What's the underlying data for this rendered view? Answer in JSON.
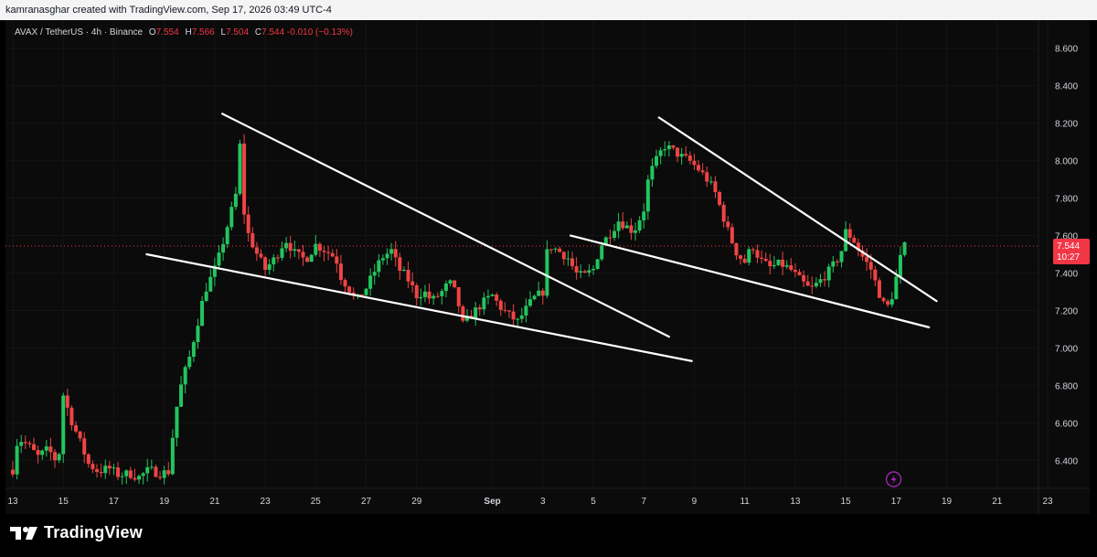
{
  "header": {
    "attribution": "kamranasghar created with TradingView.com, Sep 17, 2026 03:49 UTC-4"
  },
  "legend": {
    "symbol": "AVAX / TetherUS · 4h · Binance",
    "o_label": "O",
    "o_value": "7.554",
    "h_label": "H",
    "h_value": "7.566",
    "l_label": "L",
    "l_value": "7.504",
    "c_label": "C",
    "c_value": "7.544",
    "change": "-0.010 (−0.13%)"
  },
  "price_tag": {
    "price": "7.544",
    "countdown": "10:27"
  },
  "brand": {
    "name": "TradingView"
  },
  "colors": {
    "up": "#22c55e",
    "down": "#ef4444",
    "trendline": "#ffffff",
    "tag": "#f23645",
    "grid": "#141414"
  },
  "chart_data": {
    "type": "candlestick",
    "title": "AVAX / TetherUS · 4h · Binance",
    "y_axis": {
      "range": [
        6.25,
        8.75
      ],
      "ticks": [
        "6.400",
        "6.600",
        "6.800",
        "7.000",
        "7.200",
        "7.400",
        "7.600",
        "7.800",
        "8.000",
        "8.200",
        "8.400",
        "8.600"
      ]
    },
    "x_axis": {
      "range": [
        13,
        54
      ],
      "ticks": [
        {
          "t": 13,
          "label": "13"
        },
        {
          "t": 15,
          "label": "15"
        },
        {
          "t": 17,
          "label": "17"
        },
        {
          "t": 19,
          "label": "19"
        },
        {
          "t": 21,
          "label": "21"
        },
        {
          "t": 23,
          "label": "23"
        },
        {
          "t": 25,
          "label": "25"
        },
        {
          "t": 27,
          "label": "27"
        },
        {
          "t": 29,
          "label": "29"
        },
        {
          "t": 32,
          "label": "Sep"
        },
        {
          "t": 34,
          "label": "3"
        },
        {
          "t": 36,
          "label": "5"
        },
        {
          "t": 38,
          "label": "7"
        },
        {
          "t": 40,
          "label": "9"
        },
        {
          "t": 42,
          "label": "11"
        },
        {
          "t": 44,
          "label": "13"
        },
        {
          "t": 46,
          "label": "15"
        },
        {
          "t": 48,
          "label": "17"
        },
        {
          "t": 50,
          "label": "19"
        },
        {
          "t": 52,
          "label": "21"
        },
        {
          "t": 54,
          "label": "23"
        }
      ]
    },
    "current_price": 7.544,
    "closes_anchor": [
      [
        13,
        6.35
      ],
      [
        13.2,
        6.52
      ],
      [
        13.6,
        6.48
      ],
      [
        14,
        6.42
      ],
      [
        14.4,
        6.46
      ],
      [
        14.8,
        6.38
      ],
      [
        15,
        6.75
      ],
      [
        15.3,
        6.62
      ],
      [
        15.6,
        6.52
      ],
      [
        16,
        6.38
      ],
      [
        16.4,
        6.34
      ],
      [
        16.8,
        6.36
      ],
      [
        17.2,
        6.32
      ],
      [
        17.6,
        6.33
      ],
      [
        18,
        6.31
      ],
      [
        18.4,
        6.35
      ],
      [
        18.8,
        6.33
      ],
      [
        19.2,
        6.34
      ],
      [
        19.4,
        6.62
      ],
      [
        19.7,
        6.82
      ],
      [
        20,
        6.95
      ],
      [
        20.3,
        7.12
      ],
      [
        20.6,
        7.3
      ],
      [
        21,
        7.42
      ],
      [
        21.2,
        7.5
      ],
      [
        21.5,
        7.65
      ],
      [
        21.9,
        7.85
      ],
      [
        22,
        8.08
      ],
      [
        22.2,
        7.65
      ],
      [
        22.6,
        7.52
      ],
      [
        23,
        7.42
      ],
      [
        23.4,
        7.48
      ],
      [
        23.8,
        7.58
      ],
      [
        24.2,
        7.5
      ],
      [
        24.6,
        7.47
      ],
      [
        25,
        7.55
      ],
      [
        25.4,
        7.52
      ],
      [
        25.8,
        7.48
      ],
      [
        26,
        7.38
      ],
      [
        26.3,
        7.32
      ],
      [
        26.6,
        7.25
      ],
      [
        27,
        7.32
      ],
      [
        27.3,
        7.4
      ],
      [
        27.6,
        7.48
      ],
      [
        28,
        7.52
      ],
      [
        28.3,
        7.42
      ],
      [
        28.6,
        7.38
      ],
      [
        29,
        7.28
      ],
      [
        29.3,
        7.3
      ],
      [
        29.6,
        7.25
      ],
      [
        30,
        7.3
      ],
      [
        30.3,
        7.35
      ],
      [
        30.6,
        7.28
      ],
      [
        30.8,
        7.12
      ],
      [
        31.2,
        7.18
      ],
      [
        31.6,
        7.24
      ],
      [
        32,
        7.28
      ],
      [
        32.3,
        7.22
      ],
      [
        32.6,
        7.18
      ],
      [
        33,
        7.14
      ],
      [
        33.3,
        7.2
      ],
      [
        33.6,
        7.26
      ],
      [
        34,
        7.3
      ],
      [
        34.2,
        7.55
      ],
      [
        34.6,
        7.52
      ],
      [
        35,
        7.48
      ],
      [
        35.3,
        7.4
      ],
      [
        35.6,
        7.38
      ],
      [
        36,
        7.42
      ],
      [
        36.3,
        7.55
      ],
      [
        36.6,
        7.6
      ],
      [
        37,
        7.68
      ],
      [
        37.3,
        7.65
      ],
      [
        37.6,
        7.62
      ],
      [
        38,
        7.74
      ],
      [
        38.2,
        7.92
      ],
      [
        38.5,
        8.0
      ],
      [
        38.8,
        8.08
      ],
      [
        39.2,
        8.05
      ],
      [
        39.5,
        8.02
      ],
      [
        39.8,
        8.0
      ],
      [
        40.2,
        7.95
      ],
      [
        40.5,
        7.9
      ],
      [
        40.8,
        7.84
      ],
      [
        41.1,
        7.72
      ],
      [
        41.4,
        7.6
      ],
      [
        41.7,
        7.5
      ],
      [
        42,
        7.46
      ],
      [
        42.3,
        7.55
      ],
      [
        42.6,
        7.47
      ],
      [
        43,
        7.43
      ],
      [
        43.4,
        7.45
      ],
      [
        43.8,
        7.42
      ],
      [
        44.2,
        7.36
      ],
      [
        44.6,
        7.31
      ],
      [
        45,
        7.36
      ],
      [
        45.4,
        7.42
      ],
      [
        45.8,
        7.5
      ],
      [
        46,
        7.62
      ],
      [
        46.3,
        7.58
      ],
      [
        46.6,
        7.5
      ],
      [
        47,
        7.42
      ],
      [
        47.3,
        7.3
      ],
      [
        47.6,
        7.2
      ],
      [
        47.9,
        7.3
      ],
      [
        48.1,
        7.45
      ],
      [
        48.3,
        7.54
      ],
      [
        48.45,
        7.544
      ]
    ],
    "trendlines": [
      {
        "name": "pattern-1-upper",
        "points": [
          [
            21.3,
            8.25
          ],
          [
            39,
            7.06
          ]
        ]
      },
      {
        "name": "pattern-1-lower",
        "points": [
          [
            18.3,
            7.5
          ],
          [
            39.9,
            6.93
          ]
        ]
      },
      {
        "name": "pattern-2-upper",
        "points": [
          [
            38.6,
            8.23
          ],
          [
            49.6,
            7.25
          ]
        ]
      },
      {
        "name": "pattern-2-lower",
        "points": [
          [
            35.1,
            7.6
          ],
          [
            49.3,
            7.11
          ]
        ]
      }
    ]
  }
}
